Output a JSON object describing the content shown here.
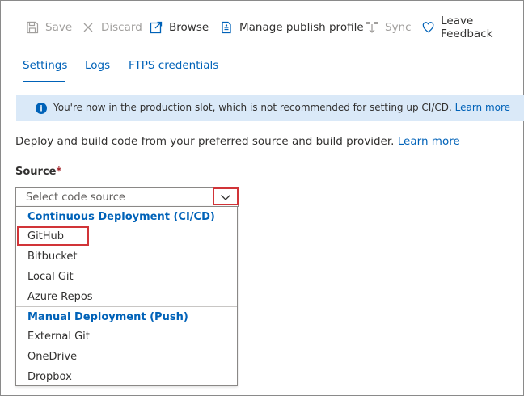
{
  "toolbar": {
    "save": {
      "label": "Save",
      "icon": "save-icon"
    },
    "discard": {
      "label": "Discard",
      "icon": "close-icon"
    },
    "browse": {
      "label": "Browse",
      "icon": "browse-icon"
    },
    "manage_publish_profile": {
      "label": "Manage publish profile",
      "icon": "document-icon"
    },
    "sync": {
      "label": "Sync",
      "icon": "sync-icon"
    },
    "leave_feedback": {
      "label": "Leave Feedback",
      "icon": "heart-icon"
    }
  },
  "tabs": [
    {
      "label": "Settings",
      "active": true
    },
    {
      "label": "Logs",
      "active": false
    },
    {
      "label": "FTPS credentials",
      "active": false
    }
  ],
  "banner": {
    "message": "You're now in the production slot, which is not recommended for setting up CI/CD.",
    "link": "Learn more",
    "icon": "info-icon"
  },
  "description": {
    "text": "Deploy and build code from your preferred source and build provider.",
    "link": "Learn more"
  },
  "source": {
    "label": "Source",
    "required_marker": "*",
    "placeholder": "Select code source",
    "groups": [
      {
        "header": "Continuous Deployment (CI/CD)",
        "options": [
          "GitHub",
          "Bitbucket",
          "Local Git",
          "Azure Repos"
        ]
      },
      {
        "header": "Manual Deployment (Push)",
        "options": [
          "External Git",
          "OneDrive",
          "Dropbox"
        ]
      }
    ]
  },
  "colors": {
    "accent": "#0062b8",
    "banner_bg": "#dae9f8",
    "highlight_red": "#d13438",
    "disabled_text": "#a19f9d"
  }
}
